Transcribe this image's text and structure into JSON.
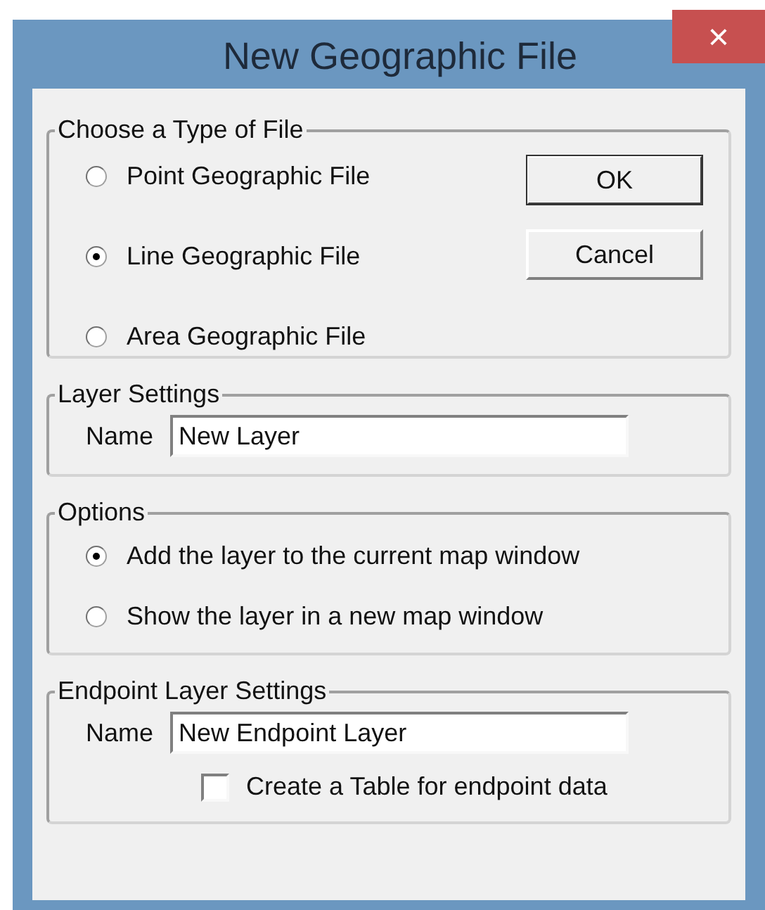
{
  "window": {
    "title": "New Geographic File",
    "close": "×"
  },
  "file_type": {
    "legend": "Choose a Type of File",
    "options": [
      {
        "label": "Point Geographic File",
        "selected": false
      },
      {
        "label": "Line Geographic File",
        "selected": true
      },
      {
        "label": "Area Geographic File",
        "selected": false
      }
    ]
  },
  "buttons": [
    "OK",
    "Cancel"
  ],
  "layer_settings": {
    "legend": "Layer Settings",
    "label": "Name",
    "value": "New Layer"
  },
  "options": {
    "legend": "Options",
    "options": [
      {
        "label": "Add the layer to the current map window",
        "selected": true
      },
      {
        "label": "Show the layer in a new map window",
        "selected": false
      }
    ]
  },
  "endpoint_settings": {
    "legend": "Endpoint Layer Settings",
    "label": "Name",
    "value": "New Endpoint Layer",
    "checkbox": {
      "label": "Create a Table for endpoint data",
      "checked": false
    }
  }
}
